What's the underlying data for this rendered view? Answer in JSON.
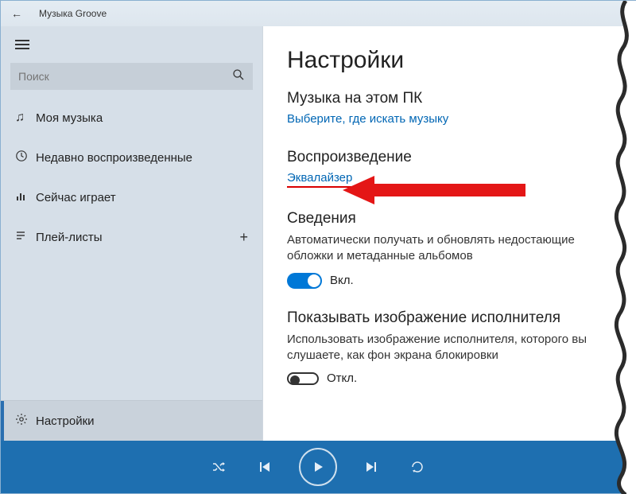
{
  "titlebar": {
    "app_name": "Музыка Groove"
  },
  "sidebar": {
    "search_placeholder": "Поиск",
    "items": [
      {
        "label": "Моя музыка"
      },
      {
        "label": "Недавно воспроизведенные"
      },
      {
        "label": "Сейчас играет"
      },
      {
        "label": "Плей-листы"
      }
    ],
    "settings_label": "Настройки"
  },
  "content": {
    "heading": "Настройки",
    "music_section": {
      "title": "Музыка на этом ПК",
      "link": "Выберите, где искать музыку"
    },
    "playback_section": {
      "title": "Воспроизведение",
      "link": "Эквалайзер"
    },
    "about_section": {
      "title": "Сведения",
      "desc": "Автоматически получать и обновлять недостающие обложки и метаданные альбомов",
      "toggle_label": "Вкл."
    },
    "artist_section": {
      "title": "Показывать изображение исполнителя",
      "desc": "Использовать изображение исполнителя, которого вы слушаете, как фон экрана блокировки",
      "toggle_label": "Откл."
    }
  }
}
